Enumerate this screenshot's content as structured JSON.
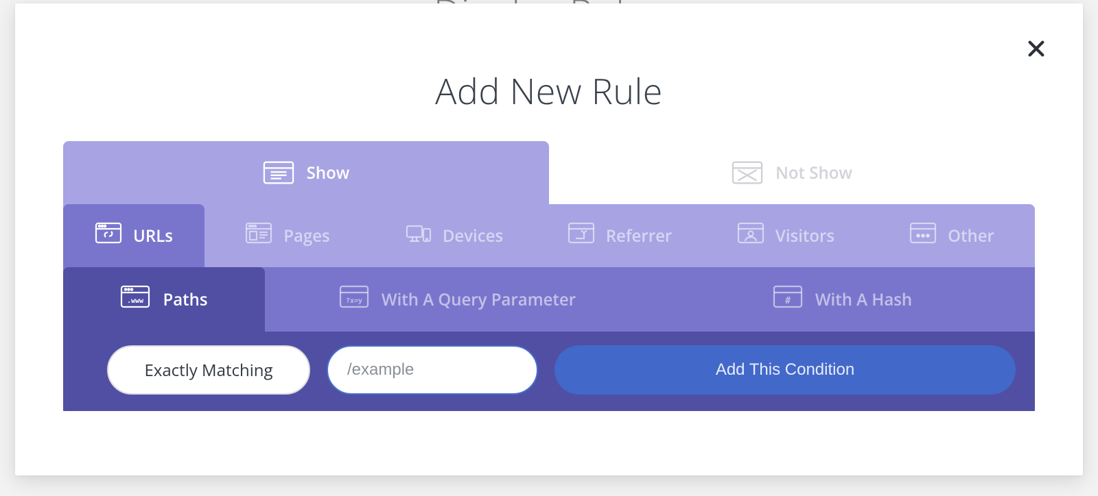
{
  "backdrop": {
    "title": "Display Rules"
  },
  "modal": {
    "title": "Add New Rule",
    "close_label": "Close"
  },
  "tabs_level1": {
    "show": {
      "label": "Show",
      "active": true
    },
    "not_show": {
      "label": "Not Show",
      "active": false
    }
  },
  "tabs_level2": {
    "urls": {
      "label": "URLs",
      "active": true
    },
    "pages": {
      "label": "Pages",
      "active": false
    },
    "devices": {
      "label": "Devices",
      "active": false
    },
    "referrer": {
      "label": "Referrer",
      "active": false
    },
    "visitors": {
      "label": "Visitors",
      "active": false
    },
    "other": {
      "label": "Other",
      "active": false
    }
  },
  "tabs_level3": {
    "paths": {
      "label": "Paths",
      "active": true
    },
    "query": {
      "label": "With A Query Parameter",
      "active": false
    },
    "hash": {
      "label": "With A Hash",
      "active": false
    }
  },
  "condition": {
    "match_type": "Exactly Matching",
    "value": "",
    "placeholder": "/example",
    "add_label": "Add This Condition"
  }
}
